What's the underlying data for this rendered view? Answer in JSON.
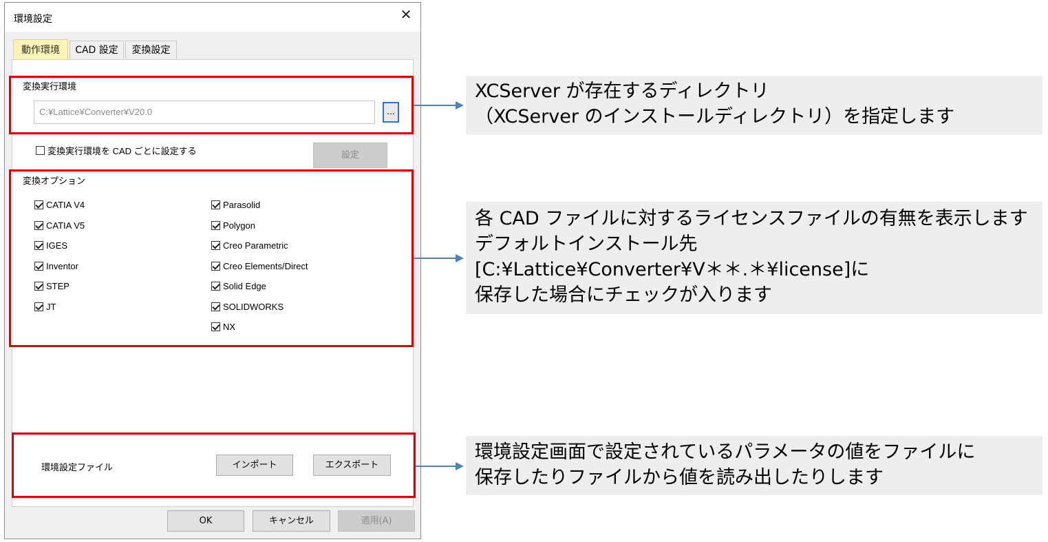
{
  "window": {
    "title": "環境設定",
    "close_glyph": "✕"
  },
  "tabs": [
    {
      "label": "動作環境"
    },
    {
      "label": "CAD 設定"
    },
    {
      "label": "変換設定"
    }
  ],
  "exec_env": {
    "label": "変換実行環境",
    "path_value": "C:¥Lattice¥Converter¥V20.0",
    "browse_label": "..."
  },
  "per_cad": {
    "label": "変換実行環境を CAD ごとに設定する",
    "checked": false,
    "settings_button": "設定"
  },
  "options": {
    "label": "変換オプション",
    "left": [
      "CATIA V4",
      "CATIA V5",
      "IGES",
      "Inventor",
      "STEP",
      "JT"
    ],
    "right": [
      "Parasolid",
      "Polygon",
      "Creo Parametric",
      "Creo Elements/Direct",
      "Solid Edge",
      "SOLIDWORKS",
      "NX"
    ]
  },
  "settings_file": {
    "label": "環境設定ファイル",
    "import_button": "インポート",
    "export_button": "エクスポート"
  },
  "footer": {
    "ok": "OK",
    "cancel": "キャンセル",
    "apply": "適用(A)"
  },
  "callouts": {
    "c1": [
      "XCServer が存在するディレクトリ",
      "（XCServer のインストールディレクトリ）を指定します"
    ],
    "c2": [
      "各 CAD ファイルに対するライセンスファイルの有無を表示します",
      "デフォルトインストール先",
      "[C:¥Lattice¥Converter¥V＊＊.＊¥license]に",
      "保存した場合にチェックが入ります"
    ],
    "c3": [
      "環境設定画面で設定されているパラメータの値をファイルに",
      "保存したりファイルから値を読み出したりします"
    ]
  },
  "colors": {
    "highlight_red": "#e00000",
    "arrow_blue": "#4f81bd",
    "active_tab": "#fdf3b6",
    "callout_bg": "#eeeeee"
  }
}
